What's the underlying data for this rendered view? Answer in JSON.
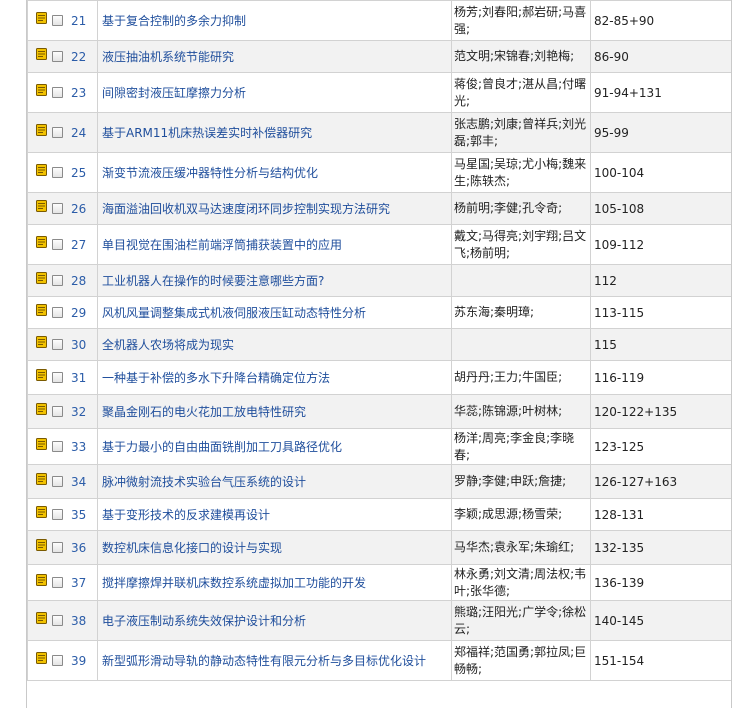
{
  "rows": [
    {
      "num": "21",
      "title": "基于复合控制的多余力抑制",
      "authors": "杨芳;刘春阳;郝岩研;马喜强;",
      "pages": "82-85+90"
    },
    {
      "num": "22",
      "title": "液压抽油机系统节能研究",
      "authors": "范文明;宋锦春;刘艳梅;",
      "pages": "86-90"
    },
    {
      "num": "23",
      "title": "间隙密封液压缸摩擦力分析",
      "authors": "蒋俊;曾良才;湛从昌;付曙光;",
      "pages": "91-94+131"
    },
    {
      "num": "24",
      "title": "基于ARM11机床热误差实时补偿器研究",
      "authors": "张志鹏;刘康;曾祥兵;刘光磊;郭丰;",
      "pages": "95-99"
    },
    {
      "num": "25",
      "title": "渐变节流液压缓冲器特性分析与结构优化",
      "authors": "马星国;吴琼;尤小梅;魏来生;陈轶杰;",
      "pages": "100-104"
    },
    {
      "num": "26",
      "title": "海面溢油回收机双马达速度闭环同步控制实现方法研究",
      "authors": "杨前明;李健;孔令奇;",
      "pages": "105-108"
    },
    {
      "num": "27",
      "title": "单目视觉在围油栏前端浮筒捕获装置中的应用",
      "authors": "戴文;马得亮;刘宇翔;吕文飞;杨前明;",
      "pages": "109-112"
    },
    {
      "num": "28",
      "title": "工业机器人在操作的时候要注意哪些方面?",
      "authors": "",
      "pages": "112"
    },
    {
      "num": "29",
      "title": "风机风量调整集成式机液伺服液压缸动态特性分析",
      "authors": "苏东海;秦明璋;",
      "pages": "113-115"
    },
    {
      "num": "30",
      "title": "全机器人农场将成为现实",
      "authors": "",
      "pages": "115"
    },
    {
      "num": "31",
      "title": "一种基于补偿的多水下升降台精确定位方法",
      "authors": "胡丹丹;王力;牛国臣;",
      "pages": "116-119"
    },
    {
      "num": "32",
      "title": "聚晶金刚石的电火花加工放电特性研究",
      "authors": "华蕊;陈锦源;叶树林;",
      "pages": "120-122+135"
    },
    {
      "num": "33",
      "title": "基于力最小的自由曲面铣削加工刀具路径优化",
      "authors": "杨洋;周亮;李金良;李晓春;",
      "pages": "123-125"
    },
    {
      "num": "34",
      "title": "脉冲微射流技术实验台气压系统的设计",
      "authors": "罗静;李健;申跃;詹捷;",
      "pages": "126-127+163"
    },
    {
      "num": "35",
      "title": "基于变形技术的反求建模再设计",
      "authors": "李颖;成思源;杨雪荣;",
      "pages": "128-131"
    },
    {
      "num": "36",
      "title": "数控机床信息化接口的设计与实现",
      "authors": "马华杰;袁永军;朱瑜红;",
      "pages": "132-135"
    },
    {
      "num": "37",
      "title": "搅拌摩擦焊并联机床数控系统虚拟加工功能的开发",
      "authors": "林永勇;刘文清;周法权;韦叶;张华德;",
      "pages": "136-139"
    },
    {
      "num": "38",
      "title": "电子液压制动系统失效保护设计和分析",
      "authors": "熊璐;汪阳光;广学令;徐松云;",
      "pages": "140-145"
    },
    {
      "num": "39",
      "title": "新型弧形滑动导轨的静动态特性有限元分析与多目标优化设计",
      "authors": "郑福祥;范国勇;郭拉凤;巨畅畅;",
      "pages": "151-154"
    }
  ],
  "row_heights": [
    40,
    32,
    40,
    40,
    40,
    32,
    40,
    32,
    32,
    32,
    34,
    34,
    36,
    34,
    32,
    34,
    36,
    40,
    40
  ],
  "colors": {
    "link": "#1f4e9c",
    "number": "#2b5ca8",
    "icon_fill": "#f2c200",
    "icon_border": "#7a5a00"
  }
}
